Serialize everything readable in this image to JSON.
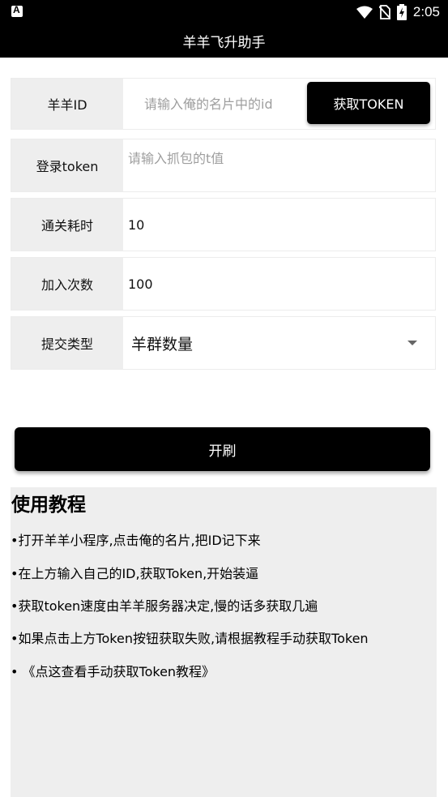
{
  "status_bar": {
    "time": "2:05"
  },
  "app_bar": {
    "title": "羊羊飞升助手"
  },
  "form": {
    "sheep_id": {
      "label": "羊羊ID",
      "placeholder": "请输入俺的名片中的id",
      "value": ""
    },
    "get_token_button": "获取TOKEN",
    "login_token": {
      "label": "登录token",
      "placeholder": "请输入抓包的t值",
      "value": ""
    },
    "clear_time": {
      "label": "通关耗时",
      "value": "10"
    },
    "join_count": {
      "label": "加入次数",
      "value": "100"
    },
    "submit_type": {
      "label": "提交类型",
      "selected": "羊群数量"
    }
  },
  "start_button": "开刷",
  "tutorial": {
    "title": "使用教程",
    "items": [
      "•打开羊羊小程序,点击俺的名片,把ID记下来",
      "•在上方输入自己的ID,获取Token,开始装逼",
      "•获取token速度由羊羊服务器决定,慢的话多获取几遍",
      "•如果点击上方Token按钮获取失败,请根据教程手动获取Token",
      "• 《点这查看手动获取Token教程》"
    ]
  }
}
